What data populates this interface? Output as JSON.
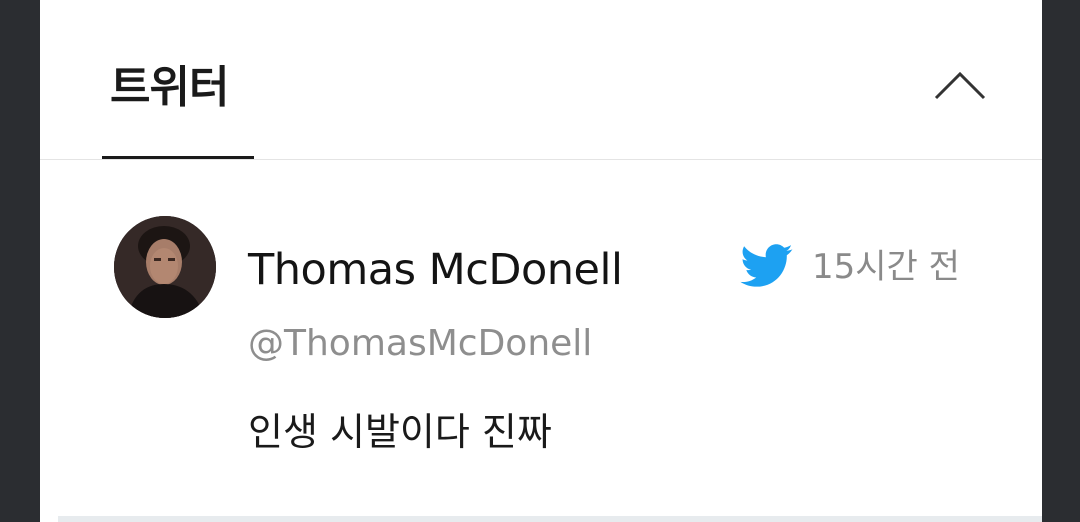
{
  "section": {
    "tab_title": "트위터",
    "collapse_icon": "chevron-up-icon"
  },
  "tweet": {
    "author_name": "Thomas McDonell",
    "handle": "@ThomasMcDonell",
    "timestamp": "15시간 전",
    "text": "인생 시발이다 진짜",
    "source_icon": "twitter-bird-icon",
    "avatar": "profile-photo"
  },
  "colors": {
    "twitter_blue": "#1da1f2",
    "page_background": "#2b2d31",
    "card_background": "#ffffff"
  }
}
